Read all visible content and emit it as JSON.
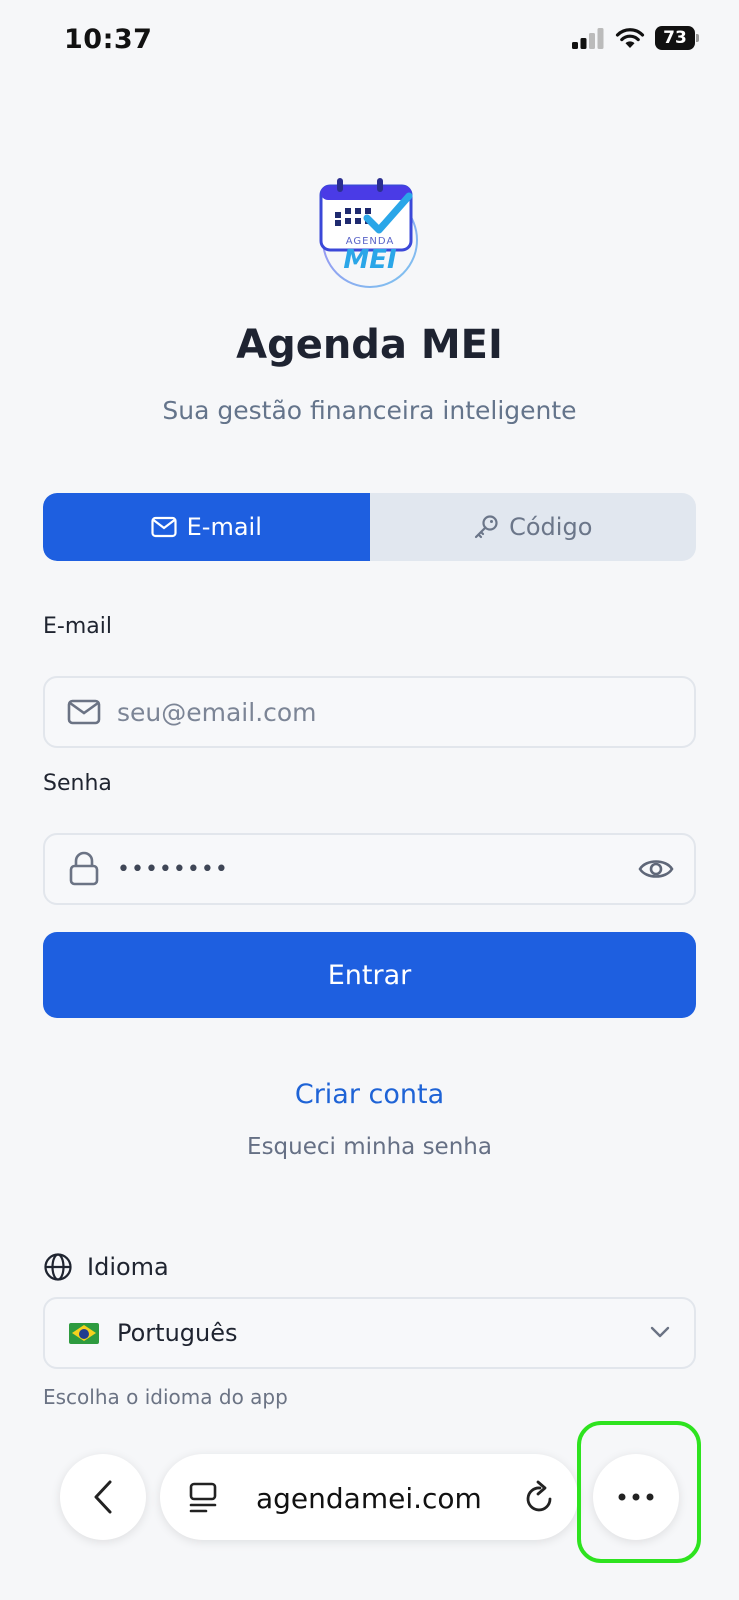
{
  "status_bar": {
    "time": "10:37",
    "battery": "73"
  },
  "app": {
    "title": "Agenda MEI",
    "subtitle": "Sua gestão financeira inteligente",
    "logo_text_top": "AGENDA",
    "logo_text_bottom": "MEI"
  },
  "tabs": [
    {
      "label": "E-mail",
      "icon": "mail-icon",
      "active": true
    },
    {
      "label": "Código",
      "icon": "key-icon",
      "active": false
    }
  ],
  "form": {
    "email_label": "E-mail",
    "email_placeholder": "seu@email.com",
    "password_label": "Senha",
    "password_value": "••••••••",
    "submit_label": "Entrar"
  },
  "links": {
    "create_account": "Criar conta",
    "forgot_password": "Esqueci minha senha"
  },
  "language": {
    "label": "Idioma",
    "selected": "Português",
    "hint": "Escolha o idioma do app"
  },
  "browser": {
    "url": "agendamei.com"
  },
  "colors": {
    "primary": "#1e5fe0",
    "link": "#1e63d6",
    "highlight": "#2ee31f"
  }
}
